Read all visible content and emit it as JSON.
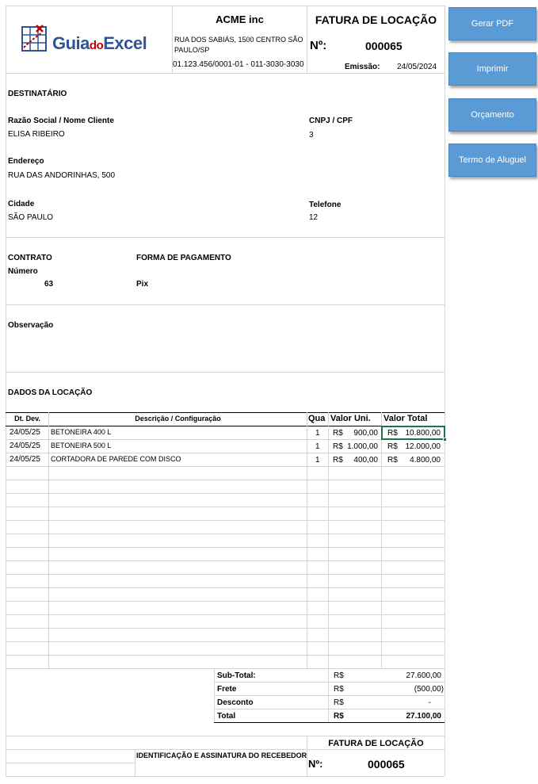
{
  "header": {
    "logo_text_guia": "Guia",
    "logo_text_do": "do",
    "logo_text_excel": "Excel",
    "company_name": "ACME inc",
    "company_address": "RUA DOS SABIÁS, 1500 CENTRO SÃO PAULO/SP",
    "company_ids": "01.123.456/0001-01 - 011-3030-3030",
    "doc_title": "FATURA DE LOCAÇÃO",
    "number_label": "Nº:",
    "number_value": "000065",
    "emission_label": "Emissão:",
    "emission_value": "24/05/2024"
  },
  "buttons": {
    "pdf": "Gerar PDF",
    "print": "Imprimir",
    "budget": "Orçamento",
    "rental_term": "Termo de Aluguel"
  },
  "recipient": {
    "section_title": "DESTINATÁRIO",
    "name_label": "Razão Social / Nome Cliente",
    "name_value": "ELISA RIBEIRO",
    "doc_label": "CNPJ / CPF",
    "doc_value": "3",
    "address_label": "Endereço",
    "address_value": "RUA DAS ANDORINHAS, 500",
    "city_label": "Cidade",
    "city_value": "SÃO PAULO",
    "phone_label": "Telefone",
    "phone_value": "12"
  },
  "contract": {
    "title": "CONTRATO",
    "number_label": "Número",
    "number_value": "63",
    "payment_label": "FORMA DE PAGAMENTO",
    "payment_value": "Pix"
  },
  "notes": {
    "label": "Observação"
  },
  "rental": {
    "section_title": "DADOS DA LOCAÇÃO",
    "columns": {
      "date": "Dt. Dev.",
      "description": "Descrição / Configuração",
      "qty": "Qua",
      "unit_value": "Valor Uni.",
      "total_value": "Valor Total"
    },
    "currency": "R$",
    "items": [
      {
        "date": "24/05/25",
        "description": "BETONEIRA 400 L",
        "qty": "1",
        "unit": "900,00",
        "total": "10.800,00"
      },
      {
        "date": "24/05/25",
        "description": "BETONEIRA 500 L",
        "qty": "1",
        "unit": "1.000,00",
        "total": "12.000,00"
      },
      {
        "date": "24/05/25",
        "description": "CORTADORA DE PAREDE COM DISCO",
        "qty": "1",
        "unit": "400,00",
        "total": "4.800,00"
      }
    ]
  },
  "totals": {
    "subtotal_label": "Sub-Total:",
    "subtotal_value": "27.600,00",
    "freight_label": "Frete",
    "freight_value": "(500,00)",
    "discount_label": "Desconto",
    "discount_value": "-",
    "total_label": "Total",
    "total_value": "27.100,00",
    "currency": "R$"
  },
  "footer": {
    "signature_label": "IDENTIFICAÇÃO E ASSINATURA DO RECEBEDOR",
    "doc_title": "FATURA DE LOCAÇÃO",
    "number_label": "Nº:",
    "number_value": "000065"
  },
  "colors": {
    "button_blue": "#5b9bd5",
    "selection_green": "#217346",
    "logo_blue": "#2f5597",
    "logo_red": "#c00000"
  }
}
